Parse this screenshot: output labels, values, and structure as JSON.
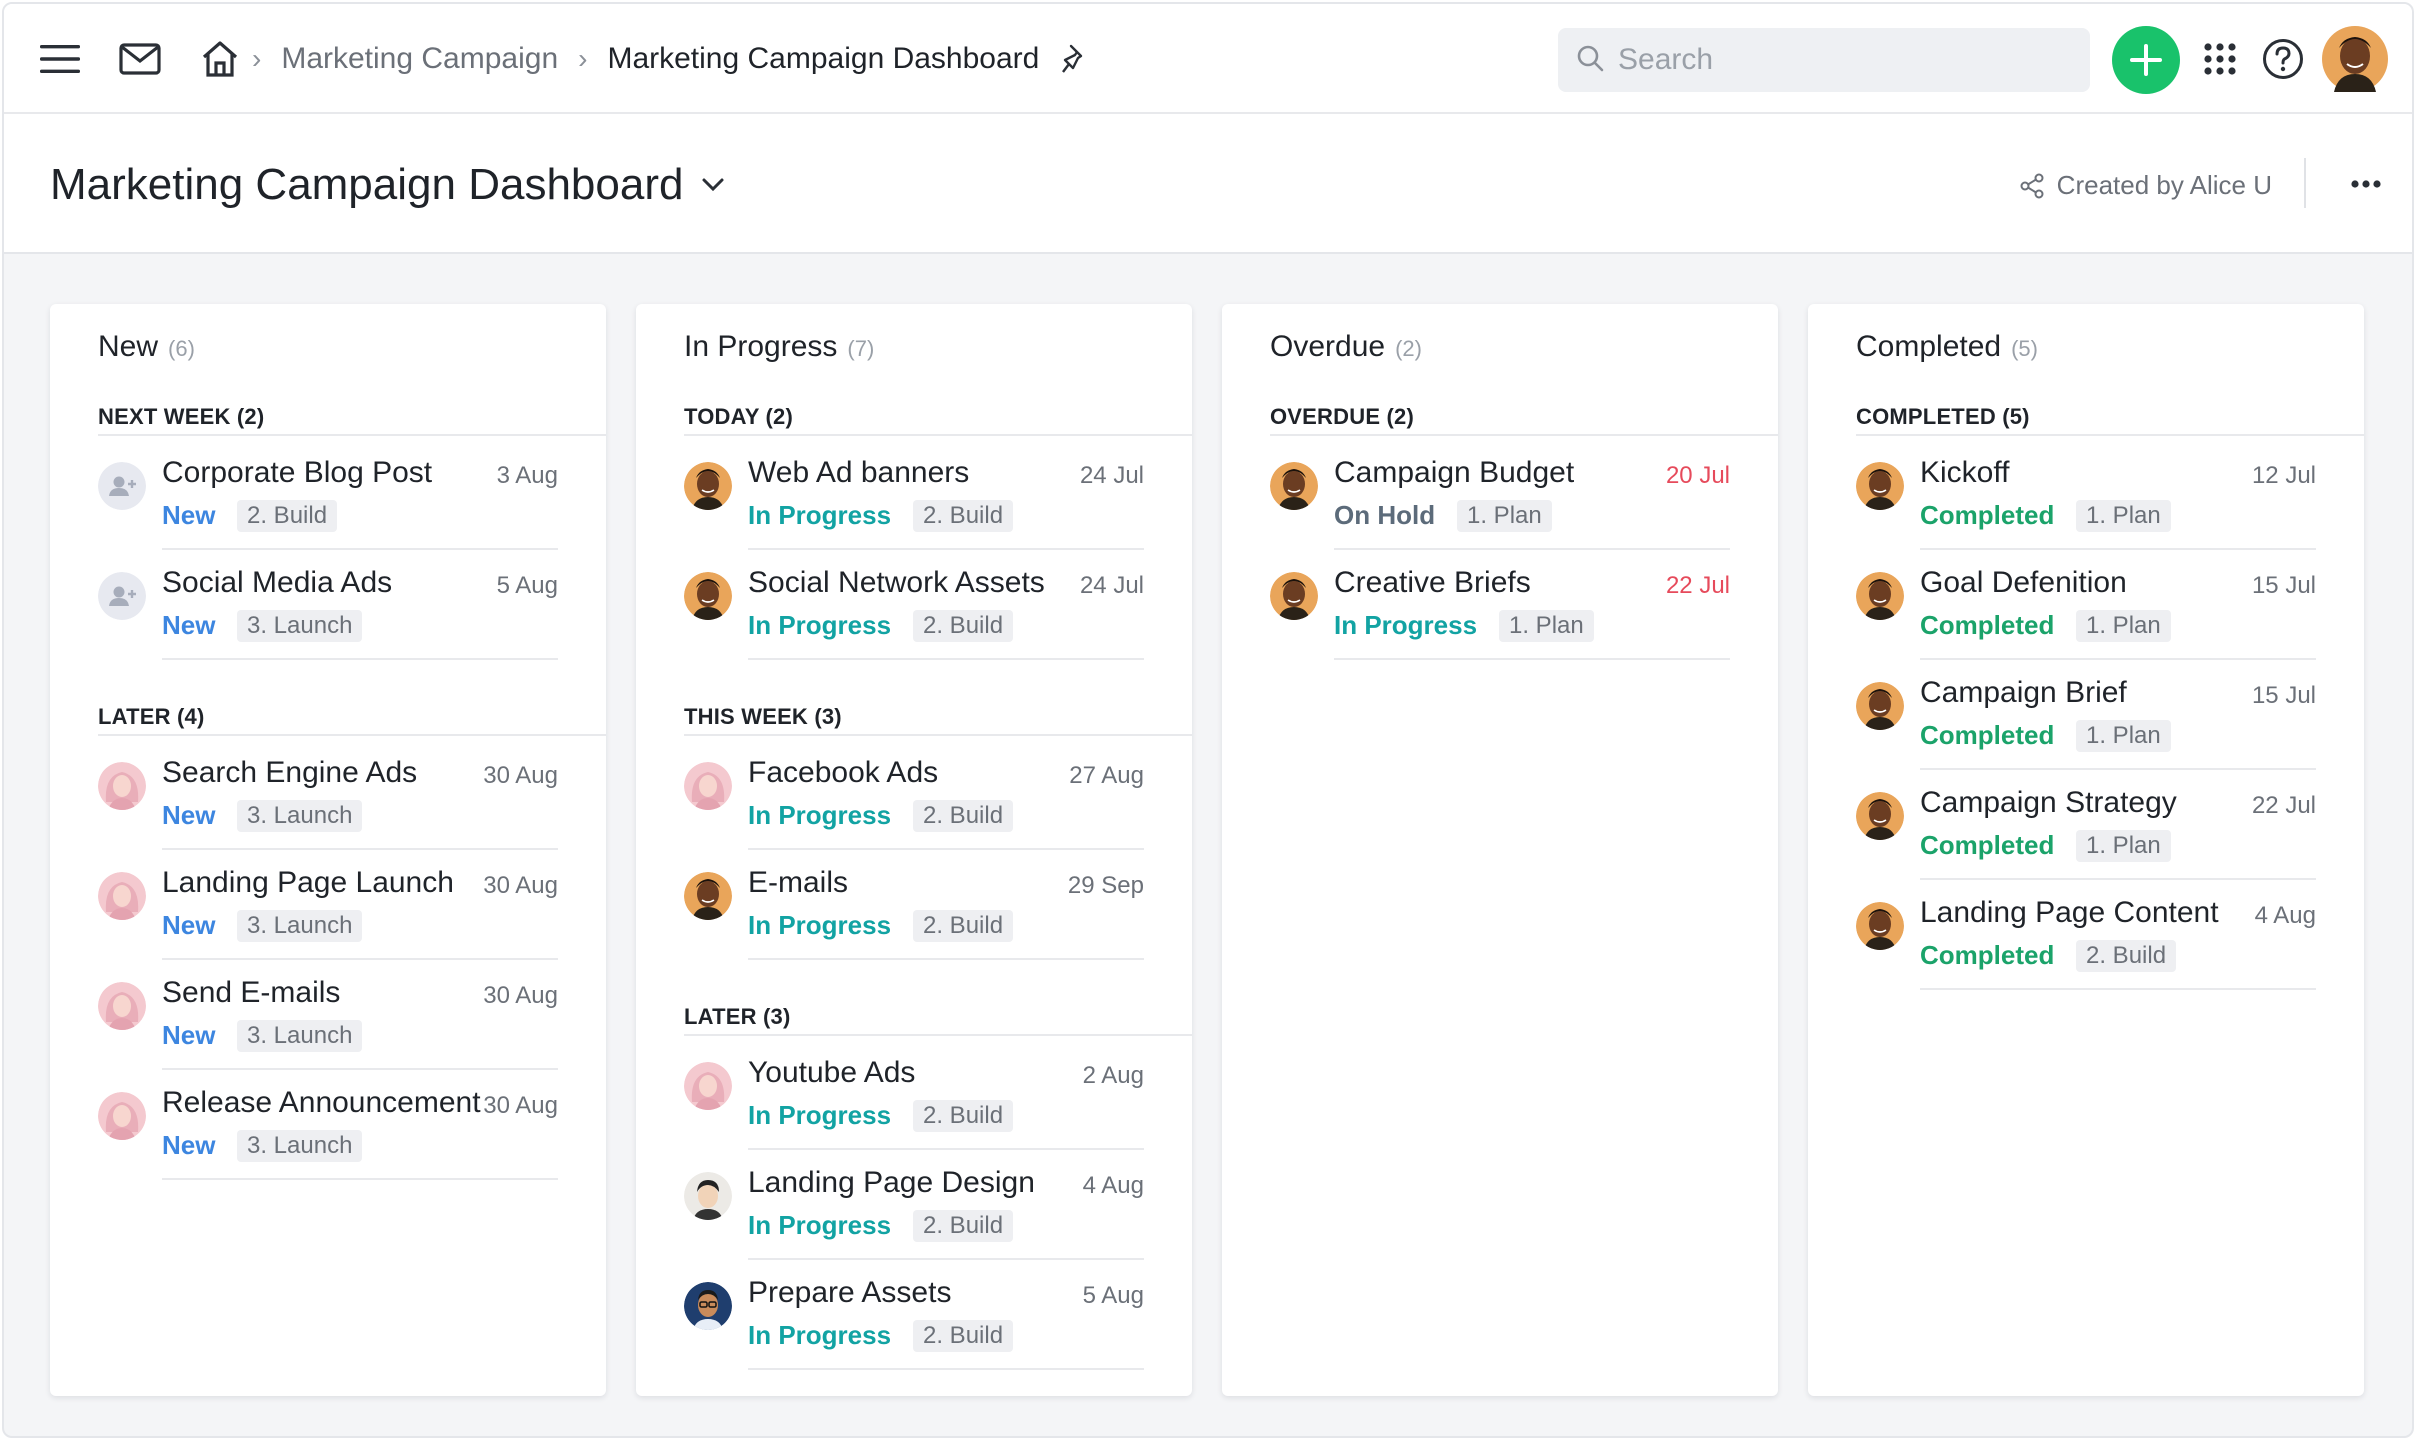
{
  "topbar": {
    "breadcrumb": {
      "parent": "Marketing Campaign",
      "current": "Marketing Campaign Dashboard"
    },
    "search_placeholder": "Search",
    "add_color": "#19c26b"
  },
  "header": {
    "title": "Marketing Campaign Dashboard",
    "created_by": "Created by Alice U"
  },
  "columns": [
    {
      "title": "New",
      "count": "(6)",
      "groups": [
        {
          "label": "NEXT WEEK (2)",
          "tasks": [
            {
              "name": "Corporate Blog Post",
              "date": "3 Aug",
              "status": "New",
              "phase": "2. Build"
            },
            {
              "name": "Social Media Ads",
              "date": "5 Aug",
              "status": "New",
              "phase": "3. Launch"
            }
          ]
        },
        {
          "label": "LATER (4)",
          "tasks": [
            {
              "name": "Search Engine Ads",
              "date": "30 Aug",
              "status": "New",
              "phase": "3. Launch"
            },
            {
              "name": "Landing Page Launch",
              "date": "30 Aug",
              "status": "New",
              "phase": "3. Launch"
            },
            {
              "name": "Send E-mails",
              "date": "30 Aug",
              "status": "New",
              "phase": "3. Launch"
            },
            {
              "name": "Release Announcement",
              "date": "30 Aug",
              "status": "New",
              "phase": "3. Launch"
            }
          ]
        }
      ]
    },
    {
      "title": "In Progress",
      "count": "(7)",
      "groups": [
        {
          "label": "TODAY (2)",
          "tasks": [
            {
              "name": "Web Ad banners",
              "date": "24 Jul",
              "status": "In Progress",
              "phase": "2. Build"
            },
            {
              "name": "Social Network Assets",
              "date": "24 Jul",
              "status": "In Progress",
              "phase": "2. Build"
            }
          ]
        },
        {
          "label": "THIS WEEK (3)",
          "tasks": [
            {
              "name": "Facebook Ads",
              "date": "27 Aug",
              "status": "In Progress",
              "phase": "2. Build"
            },
            {
              "name": "E-mails",
              "date": "29 Sep",
              "status": "In Progress",
              "phase": "2. Build"
            }
          ]
        },
        {
          "label": "LATER (3)",
          "tasks": [
            {
              "name": "Youtube Ads",
              "date": "2 Aug",
              "status": "In Progress",
              "phase": "2. Build"
            },
            {
              "name": "Landing Page Design",
              "date": "4 Aug",
              "status": "In Progress",
              "phase": "2. Build"
            },
            {
              "name": "Prepare Assets",
              "date": "5 Aug",
              "status": "In Progress",
              "phase": "2. Build"
            }
          ]
        }
      ]
    },
    {
      "title": "Overdue",
      "count": "(2)",
      "groups": [
        {
          "label": "OVERDUE (2)",
          "tasks": [
            {
              "name": "Campaign Budget",
              "date": "20 Jul",
              "status": "On Hold",
              "phase": "1. Plan"
            },
            {
              "name": "Creative Briefs",
              "date": "22 Jul",
              "status": "In Progress",
              "phase": "1. Plan"
            }
          ]
        }
      ]
    },
    {
      "title": "Completed",
      "count": "(5)",
      "groups": [
        {
          "label": "COMPLETED (5)",
          "tasks": [
            {
              "name": "Kickoff",
              "date": "12 Jul",
              "status": "Completed",
              "phase": "1. Plan"
            },
            {
              "name": "Goal Defenition",
              "date": "15 Jul",
              "status": "Completed",
              "phase": "1. Plan"
            },
            {
              "name": "Campaign Brief",
              "date": "15 Jul",
              "status": "Completed",
              "phase": "1. Plan"
            },
            {
              "name": "Campaign Strategy",
              "date": "22 Jul",
              "status": "Completed",
              "phase": "1. Plan"
            },
            {
              "name": "Landing Page Content",
              "date": "4 Aug",
              "status": "Completed",
              "phase": "2. Build"
            }
          ]
        }
      ]
    }
  ],
  "colors": {
    "new": "#3d86e0",
    "in_progress": "#12a3a3",
    "on_hold": "#5c6b7a",
    "completed": "#1ba36a",
    "overdue_date": "#e64a5b"
  }
}
